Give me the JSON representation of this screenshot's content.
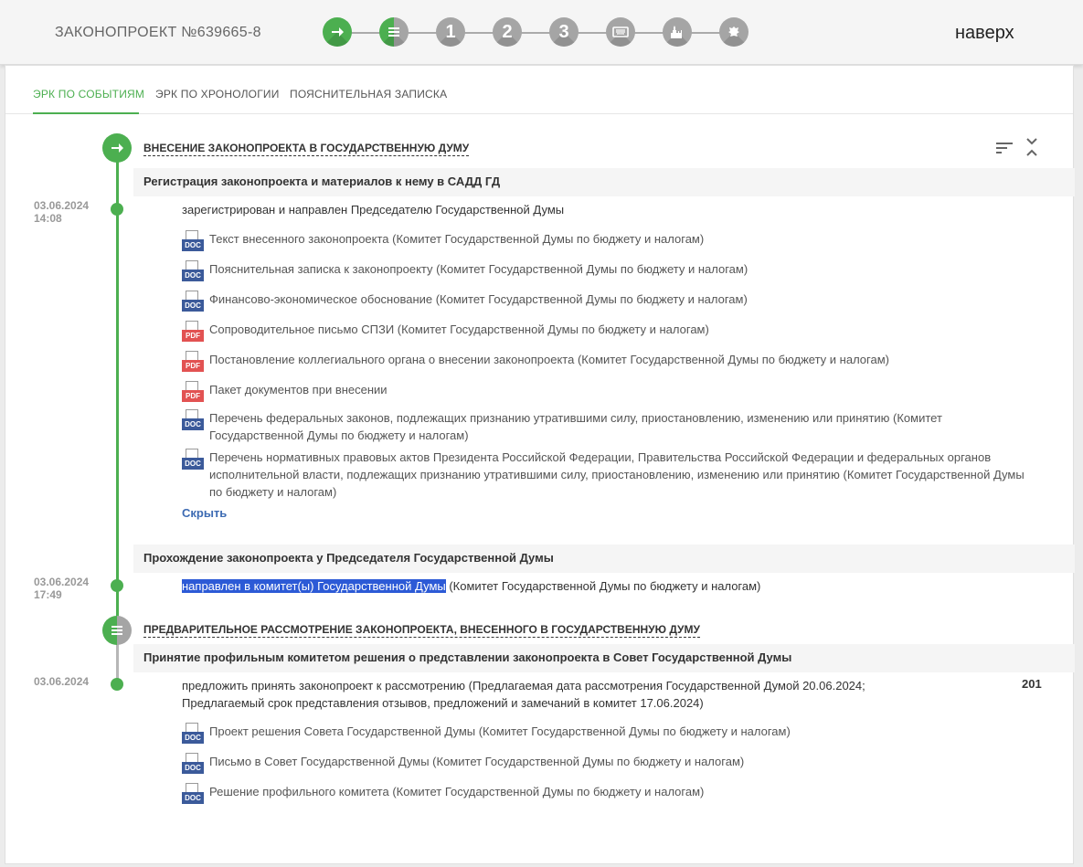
{
  "header": {
    "bill_title": "ЗАКОНОПРОЕКТ №639665-8",
    "top_link": "наверх",
    "stages": [
      {
        "label": "",
        "icon": "arrow-right-icon",
        "state": "done"
      },
      {
        "label": "",
        "icon": "document-list-icon",
        "state": "half"
      },
      {
        "label": "1",
        "icon": "",
        "state": "pending"
      },
      {
        "label": "2",
        "icon": "",
        "state": "pending"
      },
      {
        "label": "3",
        "icon": "",
        "state": "pending"
      },
      {
        "label": "",
        "icon": "keyboard-icon",
        "state": "pending"
      },
      {
        "label": "",
        "icon": "kremlin-icon",
        "state": "pending"
      },
      {
        "label": "",
        "icon": "eagle-emblem-icon",
        "state": "pending"
      }
    ]
  },
  "tabs": [
    {
      "label": "ЭРК ПО СОБЫТИЯМ",
      "active": true
    },
    {
      "label": "ЭРК ПО ХРОНОЛОГИИ",
      "active": false
    },
    {
      "label": "ПОЯСНИТЕЛЬНАЯ ЗАПИСКА",
      "active": false
    }
  ],
  "stage1": {
    "title": "ВНЕСЕНИЕ ЗАКОНОПРОЕКТА В ГОСУДАРСТВЕННУЮ ДУМУ",
    "event1": {
      "title": "Регистрация законопроекта и материалов к нему в САДД ГД",
      "date": "03.06.2024",
      "time": "14:08",
      "status": "зарегистрирован и направлен Председателю Государственной Думы",
      "docs": [
        {
          "type": "DOC",
          "text": "Текст внесенного законопроекта (Комитет Государственной Думы по бюджету и налогам)"
        },
        {
          "type": "DOC",
          "text": "Пояснительная записка к законопроекту (Комитет Государственной Думы по бюджету и налогам)"
        },
        {
          "type": "DOC",
          "text": "Финансово-экономическое обоснование (Комитет Государственной Думы по бюджету и налогам)"
        },
        {
          "type": "PDF",
          "text": "Сопроводительное письмо СПЗИ (Комитет Государственной Думы по бюджету и налогам)"
        },
        {
          "type": "PDF",
          "text": "Постановление коллегиального органа о внесении законопроекта (Комитет Государственной Думы по бюджету и налогам)"
        },
        {
          "type": "PDF",
          "text": "Пакет документов при внесении"
        },
        {
          "type": "DOC",
          "text": "Перечень федеральных законов, подлежащих признанию утратившими силу, приостановлению, изменению или принятию (Комитет Государственной Думы по бюджету и налогам)"
        },
        {
          "type": "DOC",
          "text": "Перечень нормативных правовых актов Президента Российской Федерации, Правительства Российской Федерации и федеральных органов исполнительной власти, подлежащих признанию утратившими силу, приостановлению, изменению или принятию (Комитет Государственной Думы по бюджету и налогам)"
        }
      ],
      "hide_label": "Скрыть"
    },
    "event2": {
      "title": "Прохождение законопроекта у Председателя Государственной Думы",
      "date": "03.06.2024",
      "time": "17:49",
      "status_highlight": "направлен в комитет(ы) Государственной Думы",
      "status_rest": " (Комитет Государственной Думы по бюджету и налогам)"
    }
  },
  "stage2": {
    "title": "ПРЕДВАРИТЕЛЬНОЕ РАССМОТРЕНИЕ ЗАКОНОПРОЕКТА, ВНЕСЕННОГО В ГОСУДАРСТВЕННУЮ ДУМУ",
    "event1": {
      "title": "Принятие профильным комитетом решения о представлении законопроекта в Совет Государственной Думы",
      "date": "03.06.2024",
      "number": "201",
      "status": "предложить принять законопроект к рассмотрению (Предлагаемая дата рассмотрения Государственной Думой 20.06.2024; Предлагаемый срок представления отзывов, предложений и замечаний в комитет 17.06.2024)",
      "docs": [
        {
          "type": "DOC",
          "text": "Проект решения Совета Государственной Думы (Комитет Государственной Думы по бюджету и налогам)"
        },
        {
          "type": "DOC",
          "text": "Письмо в Совет Государственной Думы (Комитет Государственной Думы по бюджету и налогам)"
        },
        {
          "type": "DOC",
          "text": "Решение профильного комитета (Комитет Государственной Думы по бюджету и налогам)"
        }
      ]
    }
  },
  "colors": {
    "accent": "#4caf50",
    "inactive": "#a5a5a5",
    "link": "#3d6bb3",
    "doc": "#3b5a9a",
    "pdf": "#e25252"
  }
}
